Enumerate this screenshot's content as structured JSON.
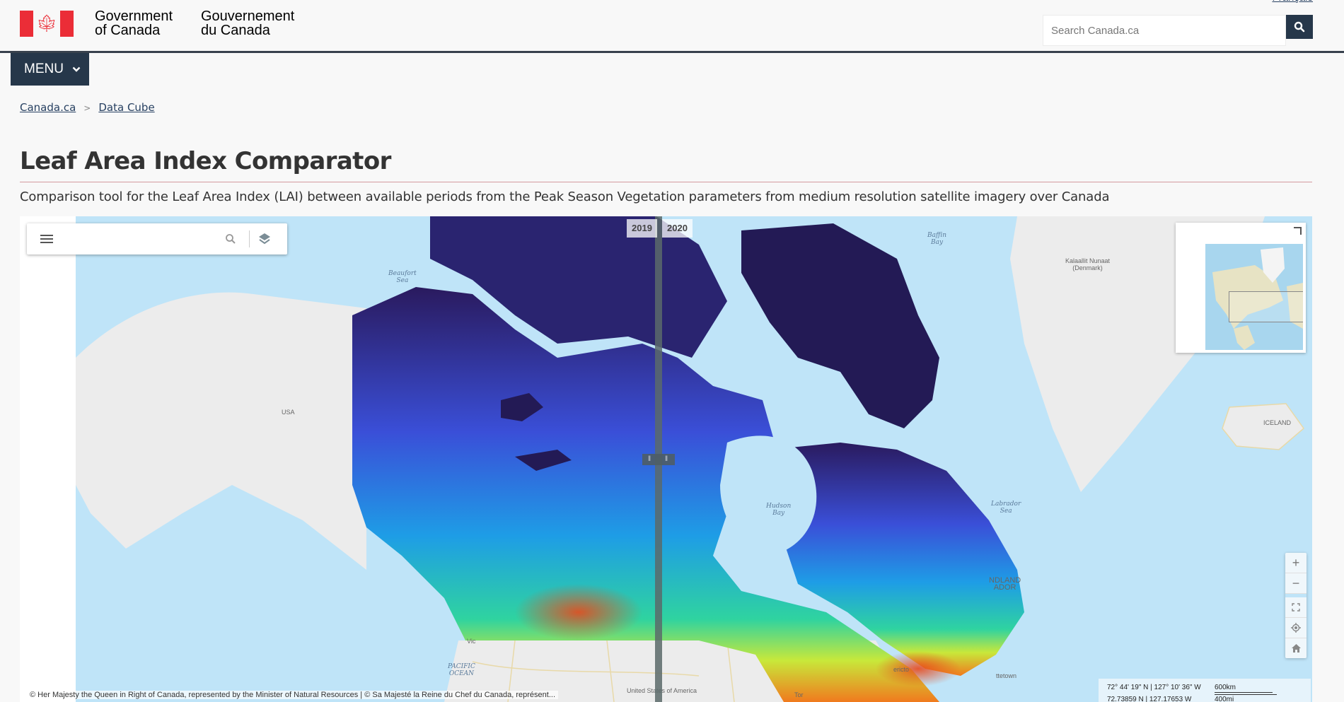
{
  "header": {
    "signature_en_line1": "Government",
    "signature_en_line2": "of Canada",
    "signature_fr_line1": "Gouvernement",
    "signature_fr_line2": "du Canada",
    "language_link": "Français",
    "search_placeholder": "Search Canada.ca",
    "flag_color": "#eb2d37"
  },
  "menu": {
    "label": "MENU"
  },
  "breadcrumb": [
    {
      "label": "Canada.ca"
    },
    {
      "label": "Data Cube"
    }
  ],
  "breadcrumb_separator": ">",
  "page": {
    "title": "Leaf Area Index Comparator",
    "description": "Comparison tool for the Leaf Area Index (LAI) between available periods from the Peak Season Vegetation parameters from medium resolution satellite imagery over Canada"
  },
  "map": {
    "swipe": {
      "left_year": "2019",
      "right_year": "2020"
    },
    "labels": {
      "beaufort": [
        "Beaufort",
        "Sea"
      ],
      "baffin": [
        "Baffin",
        "Bay"
      ],
      "greenland": [
        "Kalaallit Nunaat",
        "(Denmark)"
      ],
      "usa": "USA",
      "iceland": "ICELAND",
      "hudson": [
        "Hudson",
        "Bay"
      ],
      "labrador": [
        "Labrador",
        "Sea"
      ],
      "newfoundland": [
        "NDLAND",
        "ADOR"
      ],
      "pacific": [
        "PACIFIC",
        "OCEAN"
      ],
      "us_of_america": "United States of America",
      "victoria": "Vic",
      "toronto": "Tor",
      "fredericton": "ericto",
      "charlottetown": "ttetown"
    },
    "coordinates": {
      "dms": "72° 44' 19\" N | 127° 10' 36\" W",
      "decimal": "72.73859 N | 127.17653 W",
      "scale_km": "600km",
      "scale_mi": "400mi"
    },
    "attribution": "© Her Majesty the Queen in Right of Canada, represented by the Minister of Natural Resources | © Sa Majesté la Reine du Chef du Canada, représent...",
    "nav_buttons": [
      "zoom-in",
      "zoom-out",
      "fullscreen",
      "geolocate",
      "home"
    ]
  }
}
